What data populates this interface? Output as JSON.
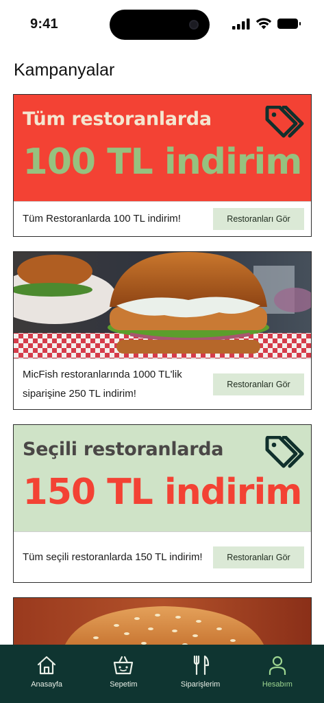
{
  "status": {
    "time": "9:41"
  },
  "header": {
    "title": "Kampanyalar"
  },
  "campaigns": [
    {
      "banner_sub": "Tüm restoranlarda",
      "banner_main": "100 TL indirim",
      "description": "Tüm Restoranlarda 100 TL indirim!",
      "cta": "Restoranları Gör",
      "bg": "#f34234",
      "sub_color": "#f4e6d0",
      "main_color": "#96c17f"
    },
    {
      "photo": "fish-burger-photo",
      "description": "MicFish restoranlarında 1000 TL'lik siparişine 250 TL indirim!",
      "cta": "Restoranları Gör"
    },
    {
      "banner_sub": "Seçili restoranlarda",
      "banner_main": "150 TL indirim",
      "description": "Tüm seçili restoranlarda 150 TL indirim!",
      "cta": "Restoranları Gör",
      "bg": "#cfe3c7",
      "sub_color": "#4a4746",
      "main_color": "#f34234"
    },
    {
      "photo": "sesame-bun-burger-photo"
    }
  ],
  "bottom_nav": {
    "items": [
      {
        "label": "Anasayfa",
        "icon": "home-icon"
      },
      {
        "label": "Sepetim",
        "icon": "basket-icon"
      },
      {
        "label": "Siparişlerim",
        "icon": "fork-knife-icon"
      },
      {
        "label": "Hesabım",
        "icon": "user-icon",
        "active": true
      }
    ],
    "active_color": "#9ed691",
    "bg": "#0f3531"
  }
}
